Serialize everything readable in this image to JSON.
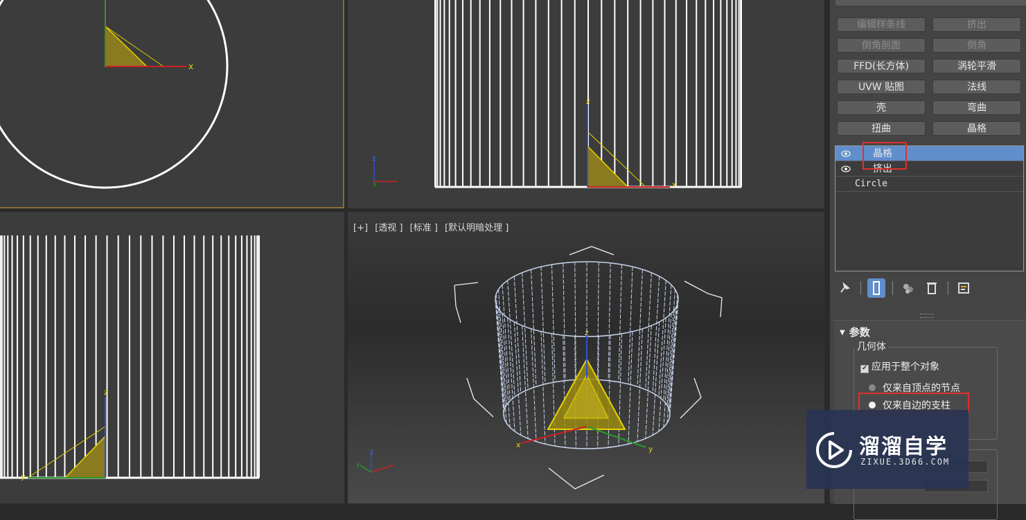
{
  "viewports": {
    "perspective_label": {
      "plus": "[+]",
      "view": "[透视 ]",
      "shading": "[标准 ]",
      "lighting": "[默认明暗处理 ]"
    },
    "axis": {
      "x": "x",
      "y": "y",
      "z": "z"
    }
  },
  "panel": {
    "modifier_buttons": [
      [
        "编辑样条线",
        "挤出"
      ],
      [
        "倒角剖面",
        "倒角"
      ],
      [
        "FFD(长方体)",
        "涡轮平滑"
      ],
      [
        "UVW 贴图",
        "法线"
      ],
      [
        "壳",
        "弯曲"
      ],
      [
        "扭曲",
        "晶格"
      ]
    ],
    "stack": {
      "items": [
        "晶格",
        "挤出",
        "Circle"
      ]
    },
    "rollout": {
      "title": "参数",
      "group_title": "几何体",
      "checkbox_label": "应用于整个对象",
      "radio_1": "仅来自顶点的节点",
      "radio_2": "仅来自边的支柱"
    }
  },
  "watermark": {
    "main": "溜溜自学",
    "sub": "ZIXUE.3D66.COM"
  },
  "colors": {
    "highlight": "#5f8ecb",
    "annotation_red": "#e03030",
    "wire_white": "#ffffff",
    "wire_blue": "#c8d4ec",
    "shape_yellow": "#e6d200"
  }
}
